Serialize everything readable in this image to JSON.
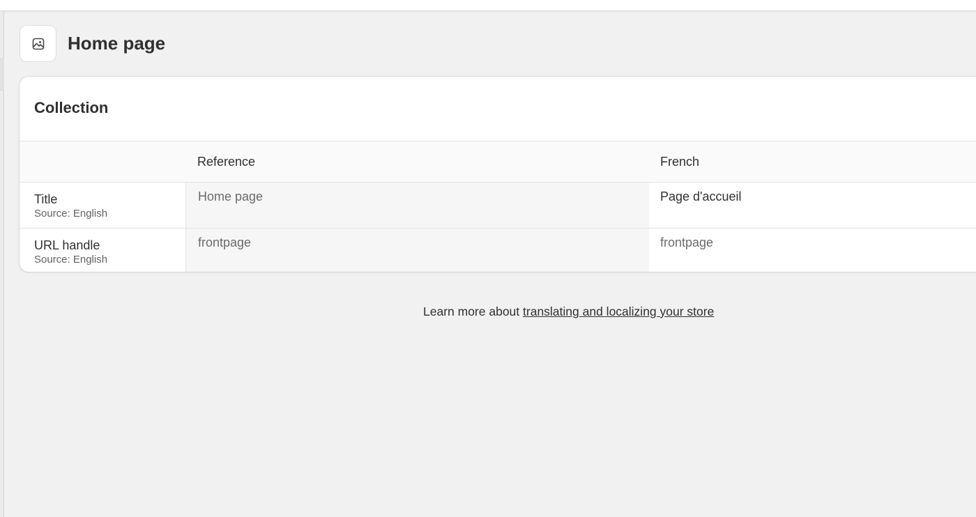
{
  "header": {
    "title": "Home page",
    "icon": "image-icon"
  },
  "card": {
    "title": "Collection",
    "columns": {
      "field": "",
      "reference": "Reference",
      "translation": "French"
    },
    "rows": [
      {
        "label": "Title",
        "source": "Source: English",
        "reference": "Home page",
        "translation": "Page d'accueil"
      },
      {
        "label": "URL handle",
        "source": "Source: English",
        "reference": "frontpage",
        "translation": "frontpage"
      }
    ]
  },
  "footer": {
    "prefix": "Learn more about ",
    "link": "translating and localizing your store"
  }
}
